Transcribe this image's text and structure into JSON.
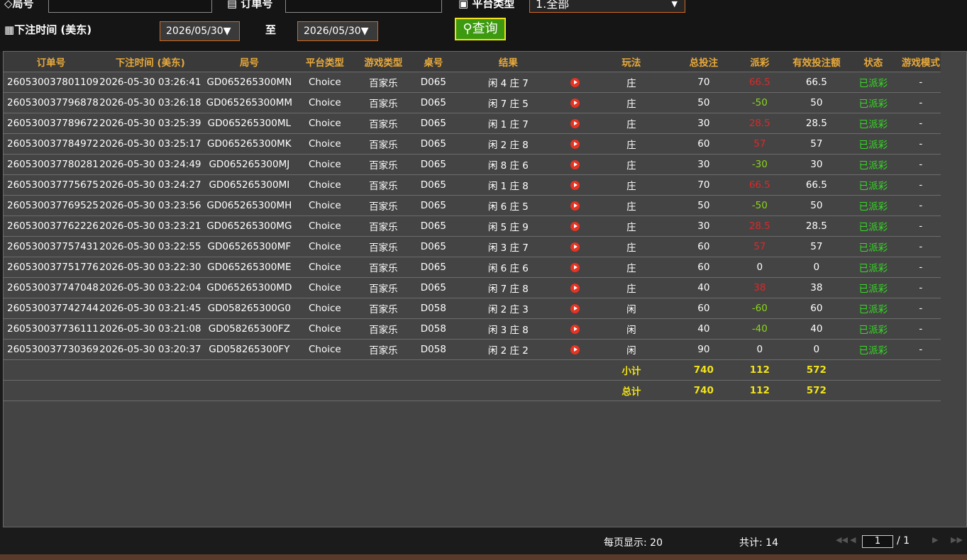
{
  "filters": {
    "round_label": "局号",
    "order_label": "订单号",
    "platform_label": "平台类型",
    "platform_value": "1.全部",
    "bet_time_label": "下注时间 (美东)",
    "date_from": "2026/05/30▼",
    "to_label": "至",
    "date_to": "2026/05/30▼",
    "query_label": "查询"
  },
  "table": {
    "headers": [
      "订单号",
      "下注时间 (美东)",
      "局号",
      "平台类型",
      "游戏类型",
      "桌号",
      "结果",
      "",
      "玩法",
      "总投注",
      "派彩",
      "有效投注额",
      "状态",
      "游戏模式"
    ],
    "rows": [
      [
        "260530037801109",
        "2026-05-30 03:26:41",
        "GD065265300MN",
        "Choice",
        "百家乐",
        "D065",
        "闲 4 庄 7",
        "庄",
        "70",
        "66.5",
        "66.5",
        "已派彩",
        "-"
      ],
      [
        "260530037796878",
        "2026-05-30 03:26:18",
        "GD065265300MM",
        "Choice",
        "百家乐",
        "D065",
        "闲 7 庄 5",
        "庄",
        "50",
        "-50",
        "50",
        "已派彩",
        "-"
      ],
      [
        "260530037789672",
        "2026-05-30 03:25:39",
        "GD065265300ML",
        "Choice",
        "百家乐",
        "D065",
        "闲 1 庄 7",
        "庄",
        "30",
        "28.5",
        "28.5",
        "已派彩",
        "-"
      ],
      [
        "260530037784972",
        "2026-05-30 03:25:17",
        "GD065265300MK",
        "Choice",
        "百家乐",
        "D065",
        "闲 2 庄 8",
        "庄",
        "60",
        "57",
        "57",
        "已派彩",
        "-"
      ],
      [
        "260530037780281",
        "2026-05-30 03:24:49",
        "GD065265300MJ",
        "Choice",
        "百家乐",
        "D065",
        "闲 8 庄 6",
        "庄",
        "30",
        "-30",
        "30",
        "已派彩",
        "-"
      ],
      [
        "260530037775675",
        "2026-05-30 03:24:27",
        "GD065265300MI",
        "Choice",
        "百家乐",
        "D065",
        "闲 1 庄 8",
        "庄",
        "70",
        "66.5",
        "66.5",
        "已派彩",
        "-"
      ],
      [
        "260530037769525",
        "2026-05-30 03:23:56",
        "GD065265300MH",
        "Choice",
        "百家乐",
        "D065",
        "闲 6 庄 5",
        "庄",
        "50",
        "-50",
        "50",
        "已派彩",
        "-"
      ],
      [
        "260530037762226",
        "2026-05-30 03:23:21",
        "GD065265300MG",
        "Choice",
        "百家乐",
        "D065",
        "闲 5 庄 9",
        "庄",
        "30",
        "28.5",
        "28.5",
        "已派彩",
        "-"
      ],
      [
        "260530037757431",
        "2026-05-30 03:22:55",
        "GD065265300MF",
        "Choice",
        "百家乐",
        "D065",
        "闲 3 庄 7",
        "庄",
        "60",
        "57",
        "57",
        "已派彩",
        "-"
      ],
      [
        "260530037751776",
        "2026-05-30 03:22:30",
        "GD065265300ME",
        "Choice",
        "百家乐",
        "D065",
        "闲 6 庄 6",
        "庄",
        "60",
        "0",
        "0",
        "已派彩",
        "-"
      ],
      [
        "260530037747048",
        "2026-05-30 03:22:04",
        "GD065265300MD",
        "Choice",
        "百家乐",
        "D065",
        "闲 7 庄 8",
        "庄",
        "40",
        "38",
        "38",
        "已派彩",
        "-"
      ],
      [
        "260530037742744",
        "2026-05-30 03:21:45",
        "GD058265300G0",
        "Choice",
        "百家乐",
        "D058",
        "闲 2 庄 3",
        "闲",
        "60",
        "-60",
        "60",
        "已派彩",
        "-"
      ],
      [
        "260530037736111",
        "2026-05-30 03:21:08",
        "GD058265300FZ",
        "Choice",
        "百家乐",
        "D058",
        "闲 3 庄 8",
        "闲",
        "40",
        "-40",
        "40",
        "已派彩",
        "-"
      ],
      [
        "260530037730369",
        "2026-05-30 03:20:37",
        "GD058265300FY",
        "Choice",
        "百家乐",
        "D058",
        "闲 2 庄 2",
        "闲",
        "90",
        "0",
        "0",
        "已派彩",
        "-"
      ]
    ],
    "subtotal": {
      "label": "小计",
      "total_bet": "740",
      "payout": "112",
      "valid_bet": "572"
    },
    "total": {
      "label": "总计",
      "total_bet": "740",
      "payout": "112",
      "valid_bet": "572"
    }
  },
  "footer": {
    "per_page": "每页显示: 20",
    "count": "共计: 14",
    "page_current": "1",
    "page_total": "/ 1"
  },
  "colors": {
    "header_text": "#e8a93b",
    "negative": "#8ad61a",
    "positive": "#d82a2a",
    "status": "#33dd22",
    "totals": "#f2e318"
  }
}
